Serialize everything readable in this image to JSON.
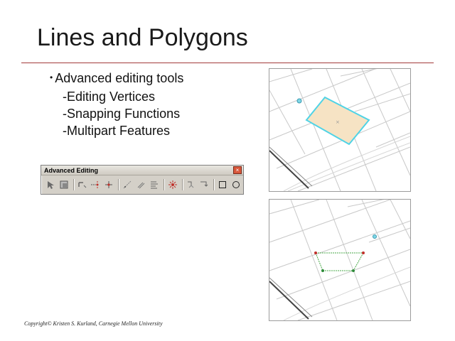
{
  "slide": {
    "title": "Lines and Polygons",
    "bullet": "Advanced editing tools",
    "sub_items": [
      "-Editing Vertices",
      "-Snapping Functions",
      "-Multipart Features"
    ],
    "copyright": "Copyright© Kristen S. Kurland, Carnegie Mellon University"
  },
  "toolbar": {
    "title": "Advanced Editing",
    "close": "×",
    "buttons": [
      "select-pointer-icon",
      "clip-icon",
      "extend-icon",
      "trim-icon",
      "line-intersection-icon",
      "inline-fillet-icon",
      "copy-parallel-icon",
      "align-icon",
      "explode-multipart-icon",
      "construct-points-icon",
      "generalize-icon",
      "rectangle-icon",
      "circle-icon"
    ]
  },
  "colors": {
    "title_rule": "#a33a3a",
    "polygon_fill": "#f6e3c4",
    "polygon_outline": "#4fd3e6",
    "vertex_red": "#c0302a",
    "vertex_green": "#2e8b3a",
    "snap_cyan": "#3fb8d0"
  }
}
